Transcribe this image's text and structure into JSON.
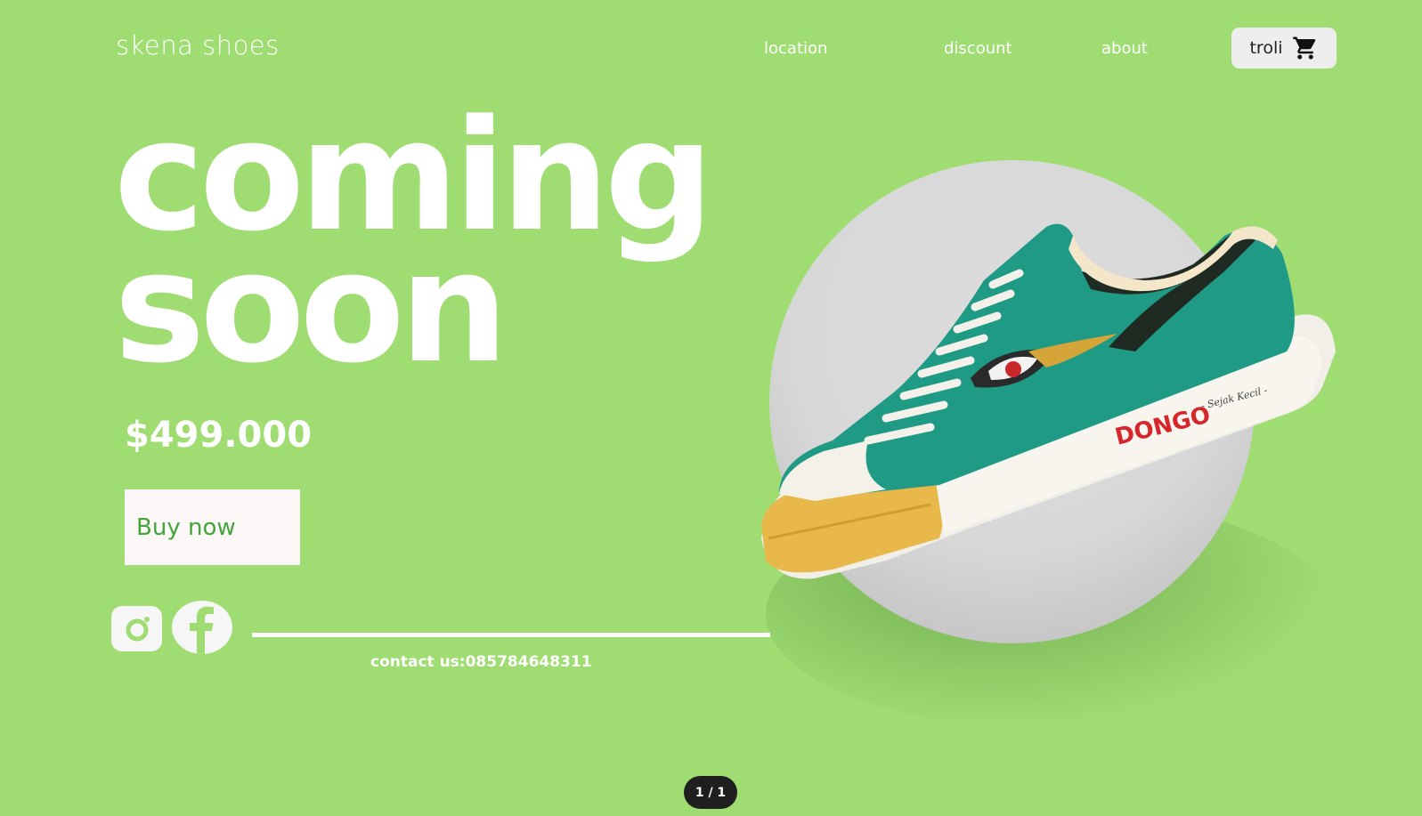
{
  "header": {
    "brand": "skena shoes",
    "nav": [
      "location",
      "discount",
      "about"
    ],
    "cart_label": "troli",
    "cart_icon": "cart-icon"
  },
  "hero": {
    "line1": "coming",
    "line2": "soon",
    "price": "$499.000",
    "buy_label": "Buy now"
  },
  "product": {
    "brand_text": "DONGO",
    "tagline": "- Sejak Kecil -"
  },
  "social": {
    "icons": [
      "instagram-icon",
      "facebook-icon"
    ],
    "contact": "contact us:085784648311"
  },
  "pager": "1 / 1",
  "colors": {
    "background": "#9fdd72",
    "button_bg": "#fcf8f8",
    "button_text": "#44a53a",
    "shoe_teal": "#1e9a85",
    "sole_yellow": "#e8b94a"
  }
}
